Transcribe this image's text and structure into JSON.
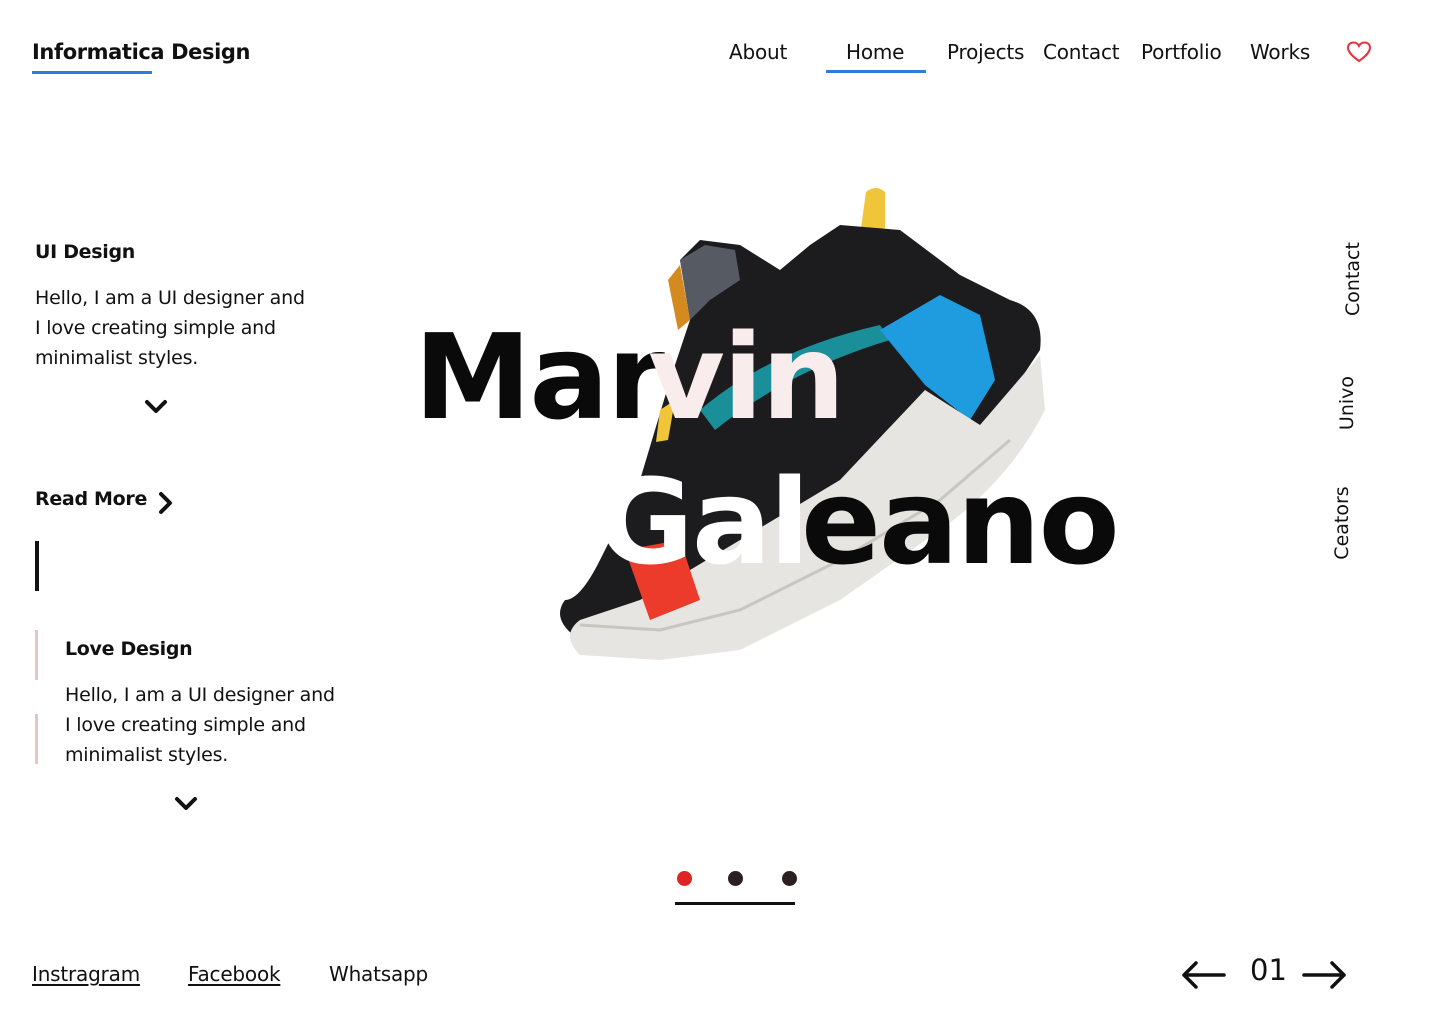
{
  "header": {
    "logo": "Informatica Design",
    "nav": [
      "About",
      "Home",
      "Projects",
      "Contact",
      "Portfolio",
      "Works"
    ],
    "active_nav": "Home",
    "accent_color": "#2f7be0",
    "heart_icon": "heart-icon",
    "heart_color": "#e5343f"
  },
  "left": {
    "section1": {
      "title": "UI Design",
      "lines": [
        "Hello, I am a UI designer and",
        "I love creating simple and",
        "minimalist styles."
      ]
    },
    "read_more": "Read More",
    "section2": {
      "title": "Love Design",
      "lines": [
        "Hello, I am a UI designer and",
        "I love creating simple and",
        "minimalist styles."
      ]
    }
  },
  "hero": {
    "line1_dark": "Mar",
    "line1_light": "vin",
    "line2_white": "Gal",
    "line2_dark": "eano",
    "light_color": "#f9ecec"
  },
  "side_links": [
    "Contact",
    "Univo",
    "Ceators"
  ],
  "slider": {
    "active_index": 0,
    "count": 3,
    "active_color": "#e02424",
    "inactive_color": "#2b1f22"
  },
  "footer": {
    "social": [
      "Instragram",
      "Facebook",
      "Whatsapp"
    ],
    "page": "01"
  }
}
